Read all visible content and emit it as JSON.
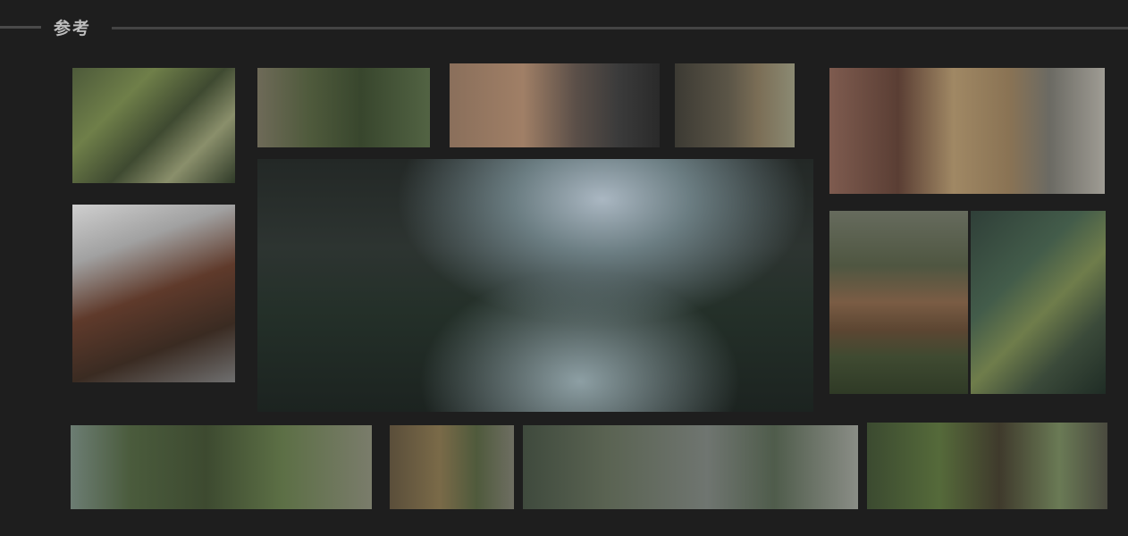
{
  "header": {
    "title": "参考"
  },
  "colors": {
    "background": "#1e1e1e",
    "accent_lines": "#444444"
  }
}
